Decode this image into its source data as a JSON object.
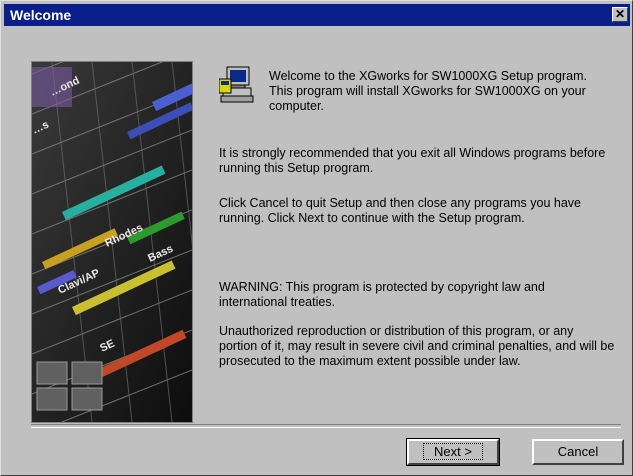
{
  "window": {
    "title": "Welcome",
    "close_glyph": "✕"
  },
  "content": {
    "intro": "Welcome to the XGworks for SW1000XG Setup program. This program will install XGworks for SW1000XG on your computer.",
    "recommend": "It is strongly recommended that you exit all Windows programs before running this Setup program.",
    "instructions": "Click Cancel to quit Setup and then close any programs you have running. Click Next to continue with the Setup program.",
    "warning": "WARNING: This program is protected by copyright law and international treaties.",
    "unauthorized": "Unauthorized reproduction or distribution of this program, or any portion of it, may result in severe civil and criminal penalties, and will be prosecuted to the maximum extent possible under law."
  },
  "side_image": {
    "labels": [
      "…ond",
      "…s",
      "Bass",
      "Rhodes",
      "Clavi/AP",
      "SE"
    ]
  },
  "buttons": {
    "next": "Next >",
    "cancel": "Cancel"
  },
  "colors": {
    "titlebar": "#0a1f8a",
    "dialog": "#c0c0c0"
  },
  "icons": [
    "setup-computer-icon",
    "close-icon"
  ]
}
